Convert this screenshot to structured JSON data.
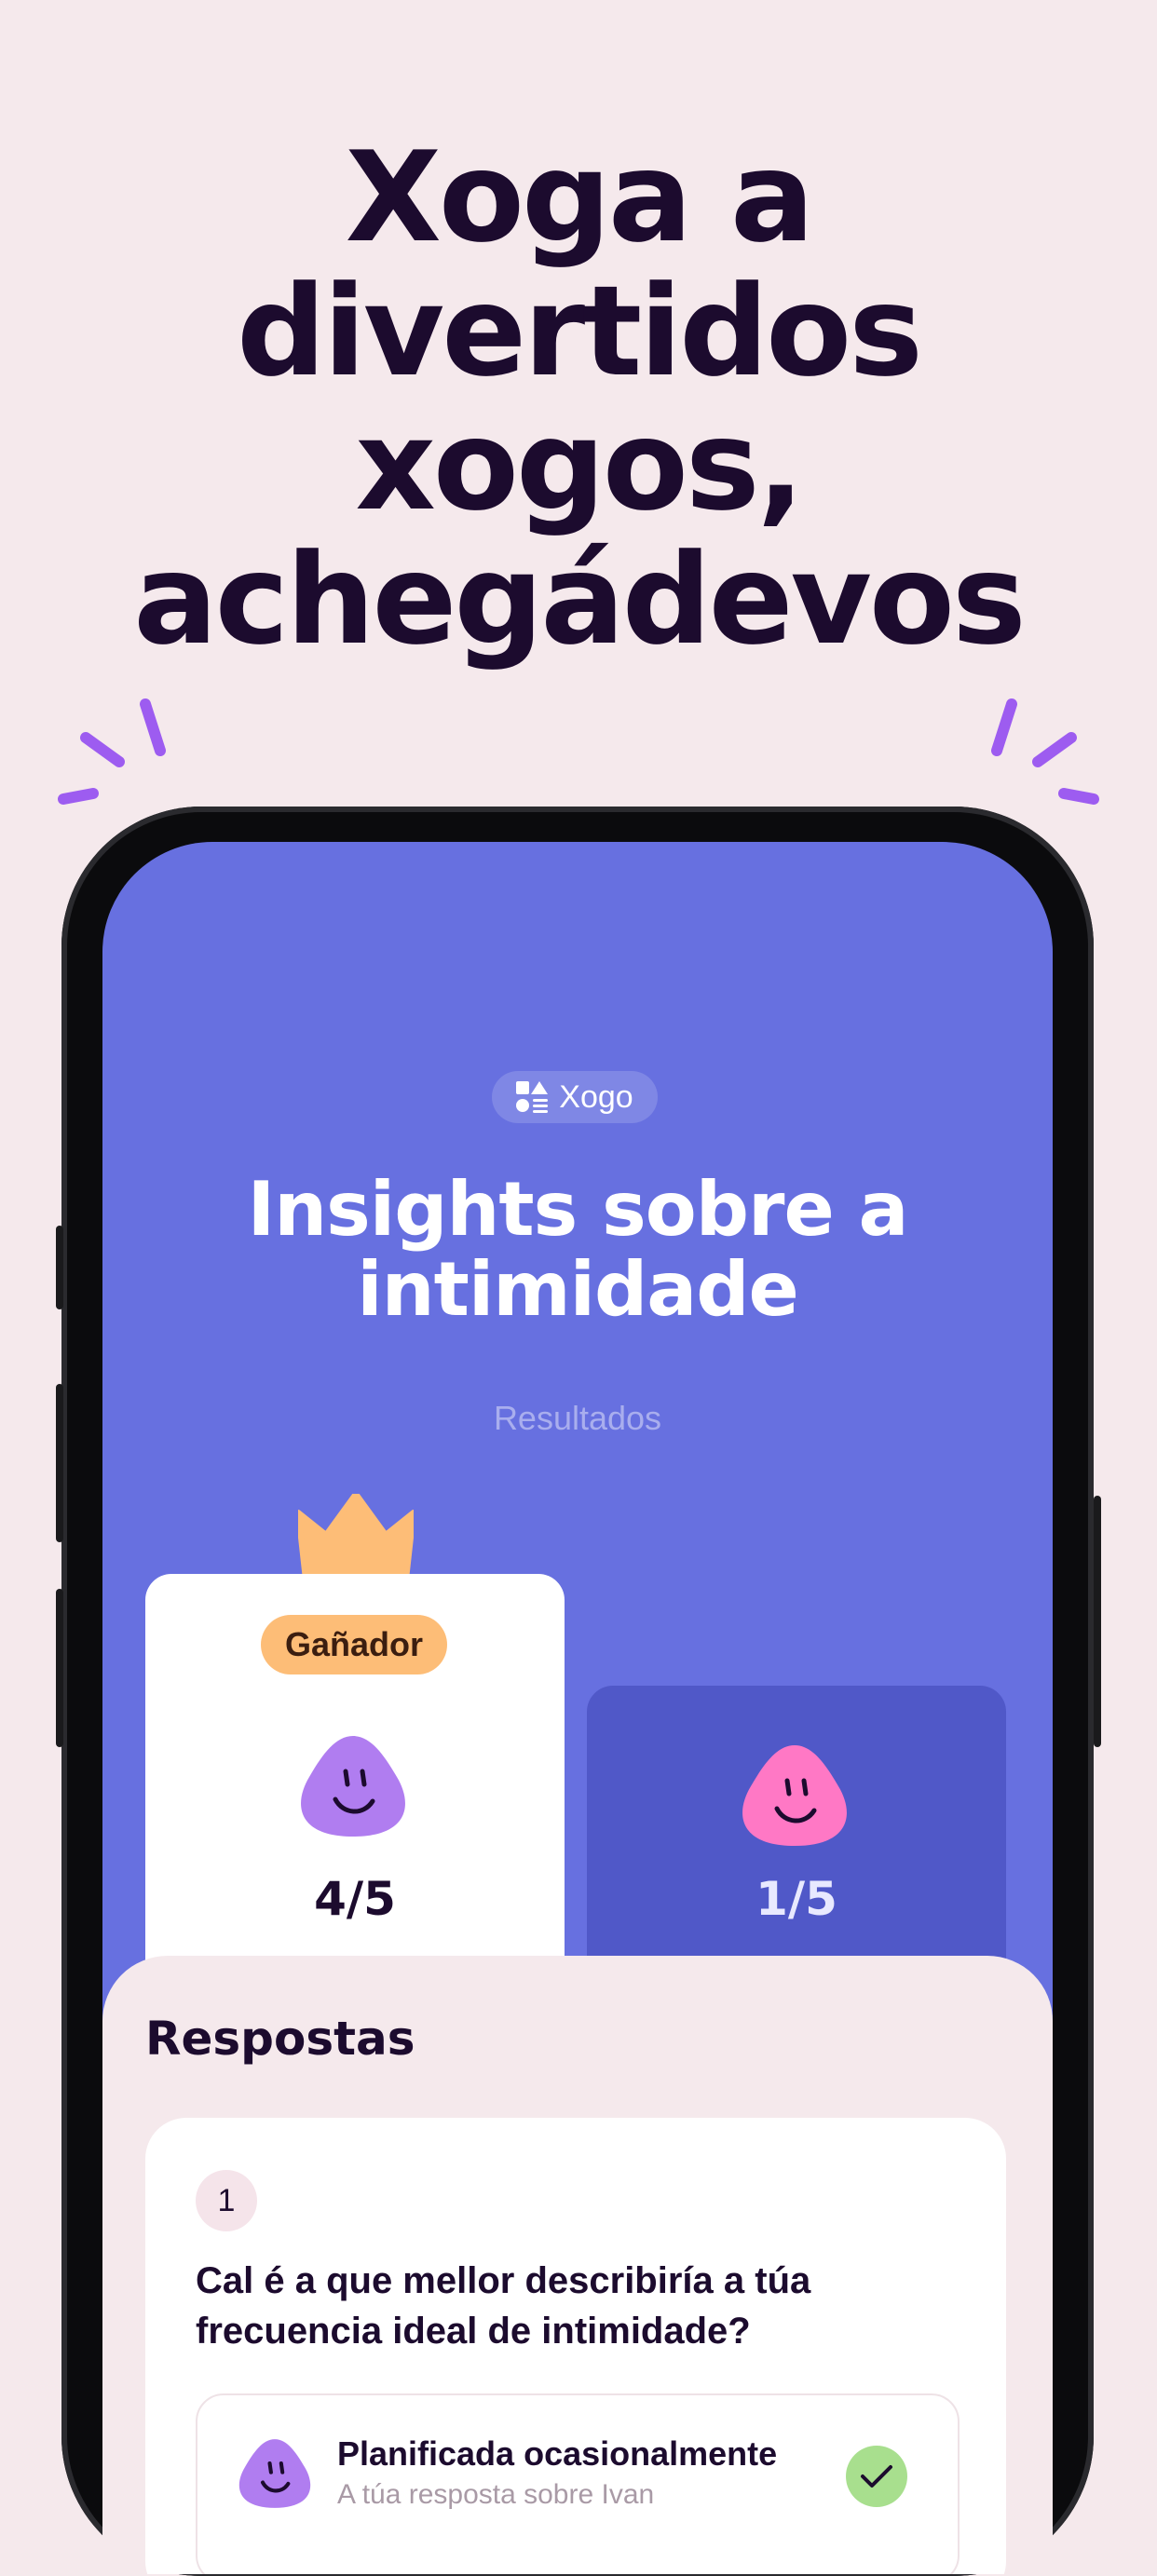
{
  "headline": [
    "Xoga a",
    "divertidos",
    "xogos,",
    "achegádevos"
  ],
  "screen": {
    "pill_label": "Xogo",
    "title": [
      "Insights sobre a",
      "intimidade"
    ],
    "subtitle": "Resultados",
    "winner": {
      "badge": "Gañador",
      "score": "4/5"
    },
    "other": {
      "score": "1/5"
    },
    "sheet_title": "Respostas",
    "question": {
      "number": "1",
      "text": "Cal é a que mellor describiría a túa frecuencia ideal de intimidade?",
      "answer_title": "Planificada ocasionalmente",
      "answer_sub": "A túa resposta sobre Ivan"
    }
  },
  "colors": {
    "background": "#f5e9ec",
    "headline": "#1c0b2e",
    "screen": "#6770e0",
    "accent_purple": "#9d5cf0",
    "badge": "#fdbd77",
    "blob_purple": "#b07df0",
    "blob_pink": "#ff78c5",
    "check": "#a8df8e"
  },
  "icons": [
    "sparkle-burst-icon",
    "game-shapes-icon",
    "crown-icon",
    "smiley-blob-icon",
    "check-icon"
  ]
}
